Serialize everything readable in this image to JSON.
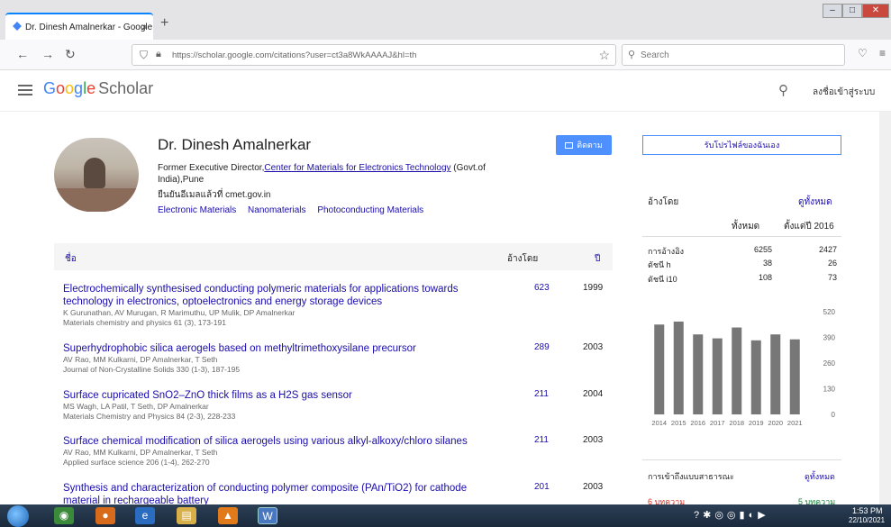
{
  "browser": {
    "tab_title": "Dr. Dinesh Amalnerkar - Google",
    "tab_close": "×",
    "new_tab": "+",
    "url": "https://scholar.google.com/citations?user=ct3a8WkAAAAJ&hl=th",
    "search_placeholder": "Search"
  },
  "header": {
    "logo_letters": [
      "G",
      "o",
      "o",
      "g",
      "l",
      "e"
    ],
    "logo_suffix": "Scholar",
    "signin": "ลงชื่อเข้าสู่ระบบ"
  },
  "profile": {
    "name": "Dr. Dinesh Amalnerkar",
    "affiliation_prefix": "Former Executive Director,",
    "affiliation_link": "Center for Materials for Electronics Technology",
    "affiliation_suffix": " (Govt.of India),Pune",
    "email": "ยืนยันอีเมลแล้วที่ cmet.gov.in",
    "interests": [
      "Electronic Materials",
      "Nanomaterials",
      "Photoconducting Materials"
    ],
    "follow_label": "ติดตาม"
  },
  "table": {
    "col_title": "ชื่อ",
    "col_cited": "อ้างโดย",
    "col_year": "ปี",
    "rows": [
      {
        "title": "Electrochemically synthesised conducting polymeric materials for applications towards technology in electronics, optoelectronics and energy storage devices",
        "authors": "K Gurunathan, AV Murugan, R Marimuthu, UP Mulik, DP Amalnerkar",
        "venue": "Materials chemistry and physics 61 (3), 173-191",
        "cited": "623",
        "year": "1999"
      },
      {
        "title": "Superhydrophobic silica aerogels based on methyltrimethoxysilane precursor",
        "authors": "AV Rao, MM Kulkarni, DP Amalnerkar, T Seth",
        "venue": "Journal of Non-Crystalline Solids 330 (1-3), 187-195",
        "cited": "289",
        "year": "2003"
      },
      {
        "title": "Surface cupricated SnO2–ZnO thick films as a H2S gas sensor",
        "authors": "MS Wagh, LA Patil, T Seth, DP Amalnerkar",
        "venue": "Materials Chemistry and Physics 84 (2-3), 228-233",
        "cited": "211",
        "year": "2004"
      },
      {
        "title": "Surface chemical modification of silica aerogels using various alkyl-alkoxy/chloro silanes",
        "authors": "AV Rao, MM Kulkarni, DP Amalnerkar, T Seth",
        "venue": "Applied surface science 206 (1-4), 262-270",
        "cited": "211",
        "year": "2003"
      },
      {
        "title": "Synthesis and characterization of conducting polymer composite (PAn/TiO2) for cathode material in rechargeable battery",
        "authors": "",
        "venue": "",
        "cited": "201",
        "year": "2003"
      }
    ]
  },
  "sidebar": {
    "get_alerts": "รับโปรไฟล์ของฉันเอง",
    "cited_by": "อ้างโดย",
    "view_all": "ดูทั้งหมด",
    "col_all": "ทั้งหมด",
    "col_since": "ตั้งแต่ปี 2016",
    "stats": [
      {
        "label": "การอ้างอิง",
        "all": "6255",
        "since": "2427"
      },
      {
        "label": "ดัชนี h",
        "all": "38",
        "since": "26"
      },
      {
        "label": "ดัชนี i10",
        "all": "108",
        "since": "73"
      }
    ],
    "open_access": "การเข้าถึงแบบสาธารณะ",
    "open_access_view_all": "ดูทั้งหมด",
    "not_available": "6 บทความ",
    "available": "5 บทความ"
  },
  "chart_data": {
    "type": "bar",
    "categories": [
      "2014",
      "2015",
      "2016",
      "2017",
      "2018",
      "2019",
      "2020",
      "2021"
    ],
    "values": [
      455,
      470,
      405,
      385,
      440,
      375,
      405,
      380
    ],
    "ylim": [
      0,
      520
    ],
    "yticks": [
      0,
      130,
      260,
      390,
      520
    ],
    "bar_color": "#777777"
  },
  "taskbar": {
    "time": "1:53 PM",
    "date": "22/10/2021"
  }
}
